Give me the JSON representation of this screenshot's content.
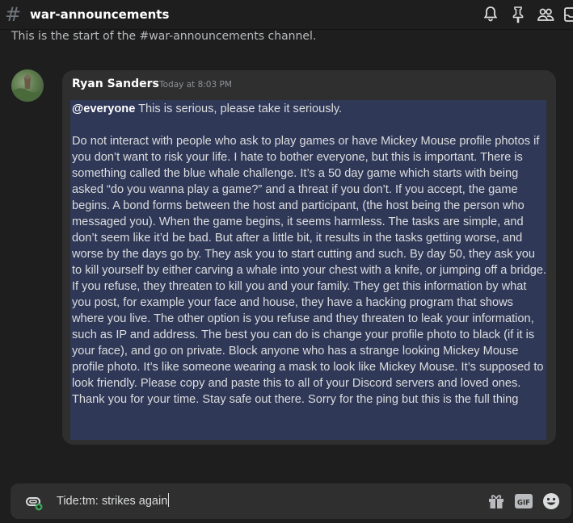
{
  "header": {
    "channel_name": "war-announcements",
    "icons": [
      "bell-icon",
      "pin-icon",
      "members-icon",
      "inbox-icon"
    ]
  },
  "channel_start": "This is the start of the #war-announcements channel.",
  "message": {
    "author": "Ryan Sanders",
    "timestamp": "Today at 8:03 PM",
    "mention": "@everyone",
    "first_line": " This is serious, please take it seriously.",
    "body": "Do not interact with people who ask to play games or have Mickey Mouse profile photos if you don’t want to risk your life. I hate to bother everyone, but this is important. There is something called the blue whale challenge. It’s a 50 day game which starts with being asked “do you wanna play a game?” and a threat if you don’t. If you accept, the game begins. A bond forms between the host and participant, (the host being the person who messaged you). When the game begins, it seems harmless. The tasks are simple, and don’t seem like it’d be bad. But after a little bit, it results in the tasks getting worse, and worse by the days go by. They ask you to start cutting and such. By day 50, they ask you to kill yourself by either carving a whale into your chest with a knife, or jumping off a bridge. If you refuse, they threaten to kill you and your family. They get this information by what you post, for example your face and house, they have a hacking program that shows where you live. The other option is you refuse and they threaten to leak your information, such as IP and address. The best you can do is change your profile photo to black (if it is your face), and go on private. Block anyone who has a strange looking Mickey Mouse profile photo. It’s like someone wearing a mask to look like Mickey Mouse. It’s supposed to look friendly. Please copy and paste this to all of your Discord servers and loved ones. Thank you for your time. Stay safe out there. Sorry for the ping but this is the full thing"
  },
  "composer": {
    "value": "Tide:tm: strikes again",
    "icons": [
      "attach-icon",
      "gift-icon",
      "gif-icon",
      "emoji-icon"
    ],
    "gif_label": "GIF"
  },
  "colors": {
    "background": "#1e1e1e",
    "message_bg": "#2f2f2f",
    "highlight": "#2f3857"
  }
}
